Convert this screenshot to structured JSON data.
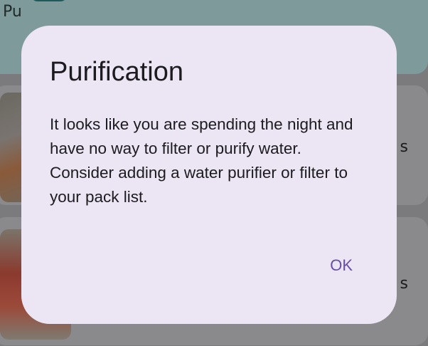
{
  "background": {
    "top_card_label": "Pu",
    "card1_trailing_text": "s",
    "card2_trailing_text": "s"
  },
  "dialog": {
    "title": "Purification",
    "message": "It looks like you are spending the night and have no way to filter or purify water. Consider adding a water purifier or filter to your pack list.",
    "ok_label": "OK"
  },
  "colors": {
    "dialog_surface": "#ece5f3",
    "accent": "#6750a4",
    "scrim_bg": "#7b7b7d",
    "top_card": "#7f9a9a"
  },
  "icons": {
    "top_card_icon": "cup-icon"
  }
}
